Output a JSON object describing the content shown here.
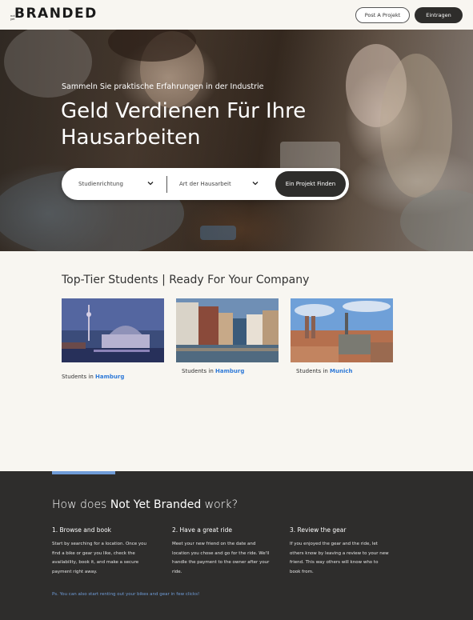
{
  "header": {
    "logo_prefix": "not yet",
    "logo": "BRANDED",
    "post_button": "Post A Projekt",
    "signup_button": "Eintragen"
  },
  "hero": {
    "subtitle": "Sammeln Sie praktische Erfahrungen in der Industrie",
    "title": "Geld Verdienen Für Ihre Hausarbeiten",
    "search": {
      "dropdown1": "Studienrichtung",
      "dropdown2": "Art der Hausarbeit",
      "button": "Ein Projekt Finden"
    }
  },
  "students": {
    "title": "Top-Tier Students | Ready For Your Company",
    "cards": [
      {
        "prefix": "Students in ",
        "city": "Hamburg"
      },
      {
        "prefix": "Students in ",
        "city": "Hamburg"
      },
      {
        "prefix": "Students in ",
        "city": "Munich"
      }
    ]
  },
  "how": {
    "title_prefix": "How does ",
    "title_brand": "Not Yet Branded",
    "title_suffix": " work?",
    "steps": [
      {
        "title": "1. Browse and book",
        "text": "Start by searching for a location. Once you find a bike or gear you like, check the availability, book it, and make a secure payment right away."
      },
      {
        "title": "2. Have a great ride",
        "text": "Meet your new friend on the date and location you chose and go for the ride. We'll handle the payment to the owner after your ride."
      },
      {
        "title": "3. Review the gear",
        "text": "If you enjoyed the gear and the ride, let others know by leaving a review to your new friend. This way others will know who to book from."
      }
    ],
    "ps": "Ps. You can also start renting out your bikes and gear in few clicks!"
  },
  "colors": {
    "accent": "#2f7ad8",
    "dark": "#2e2d2c",
    "background": "#f8f6f1",
    "footer_accent": "#6f9cd8"
  },
  "icons": [
    "chevron-down-icon"
  ]
}
